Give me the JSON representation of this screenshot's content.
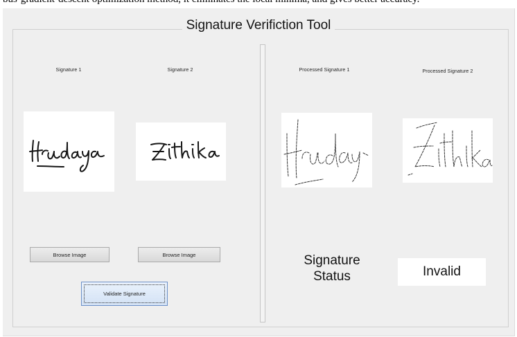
{
  "caption": "bus-gradient-descent optimization method, it eliminates the local minima, and gives better accuracy.",
  "title": "Signature Verifiction Tool",
  "left_panel": {
    "signature1_label": "Signature 1",
    "signature2_label": "Signature 2",
    "browse1_label": "Browse Image",
    "browse2_label": "Browse Image",
    "validate_label": "Validate Signature"
  },
  "right_panel": {
    "processed1_label": "Processed Signature 1",
    "processed2_label": "Processed Signature 2",
    "status_label": "Signature\nStatus",
    "status_value": "Invalid"
  },
  "colors": {
    "window_bg": "#efefef",
    "validate_border": "#6a8fc7"
  },
  "icons": {
    "signature1_image": "handwritten-signature-hrudaya",
    "signature2_image": "handwritten-signature-rithika",
    "processed1_image": "thinned-signature-hrudaya",
    "processed2_image": "thinned-signature-rithika"
  }
}
